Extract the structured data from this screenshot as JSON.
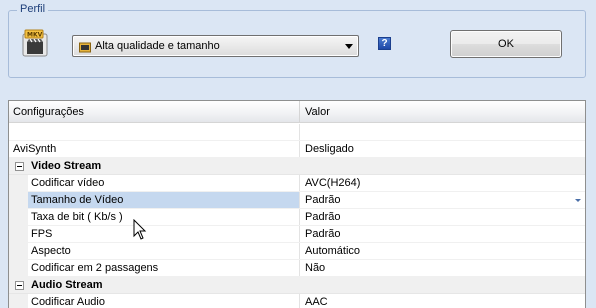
{
  "profile": {
    "legend": "Perfil",
    "format_icon": "mkv-film-icon",
    "selected_profile": "Alta qualidade e tamanho",
    "help_label": "?",
    "ok_label": "OK"
  },
  "grid": {
    "header": {
      "col1": "Configurações",
      "col2": "Valor"
    },
    "rows": {
      "blank": {
        "name": "",
        "value": ""
      },
      "avisynth": {
        "name": "AviSynth",
        "value": "Desligado"
      },
      "video_stream": {
        "name": "Video Stream"
      },
      "codificar_video": {
        "name": "Codificar vídeo",
        "value": "AVC(H264)"
      },
      "tamanho_video": {
        "name": "Tamanho de Vídeo",
        "value": "Padrão"
      },
      "taxa_bit": {
        "name": "Taxa de bit ( Kb/s )",
        "value": "Padrão"
      },
      "fps": {
        "name": "FPS",
        "value": "Padrão"
      },
      "aspecto": {
        "name": "Aspecto",
        "value": "Automático"
      },
      "duas_passagens": {
        "name": "Codificar em 2 passagens",
        "value": "Não"
      },
      "audio_stream": {
        "name": "Audio Stream"
      },
      "codificar_audio": {
        "name": "Codificar Audio",
        "value": "AAC"
      }
    }
  },
  "colors": {
    "background": "#dbe6f4",
    "selected_row": "#c5d8ef",
    "category_row": "#f0f0f0"
  }
}
